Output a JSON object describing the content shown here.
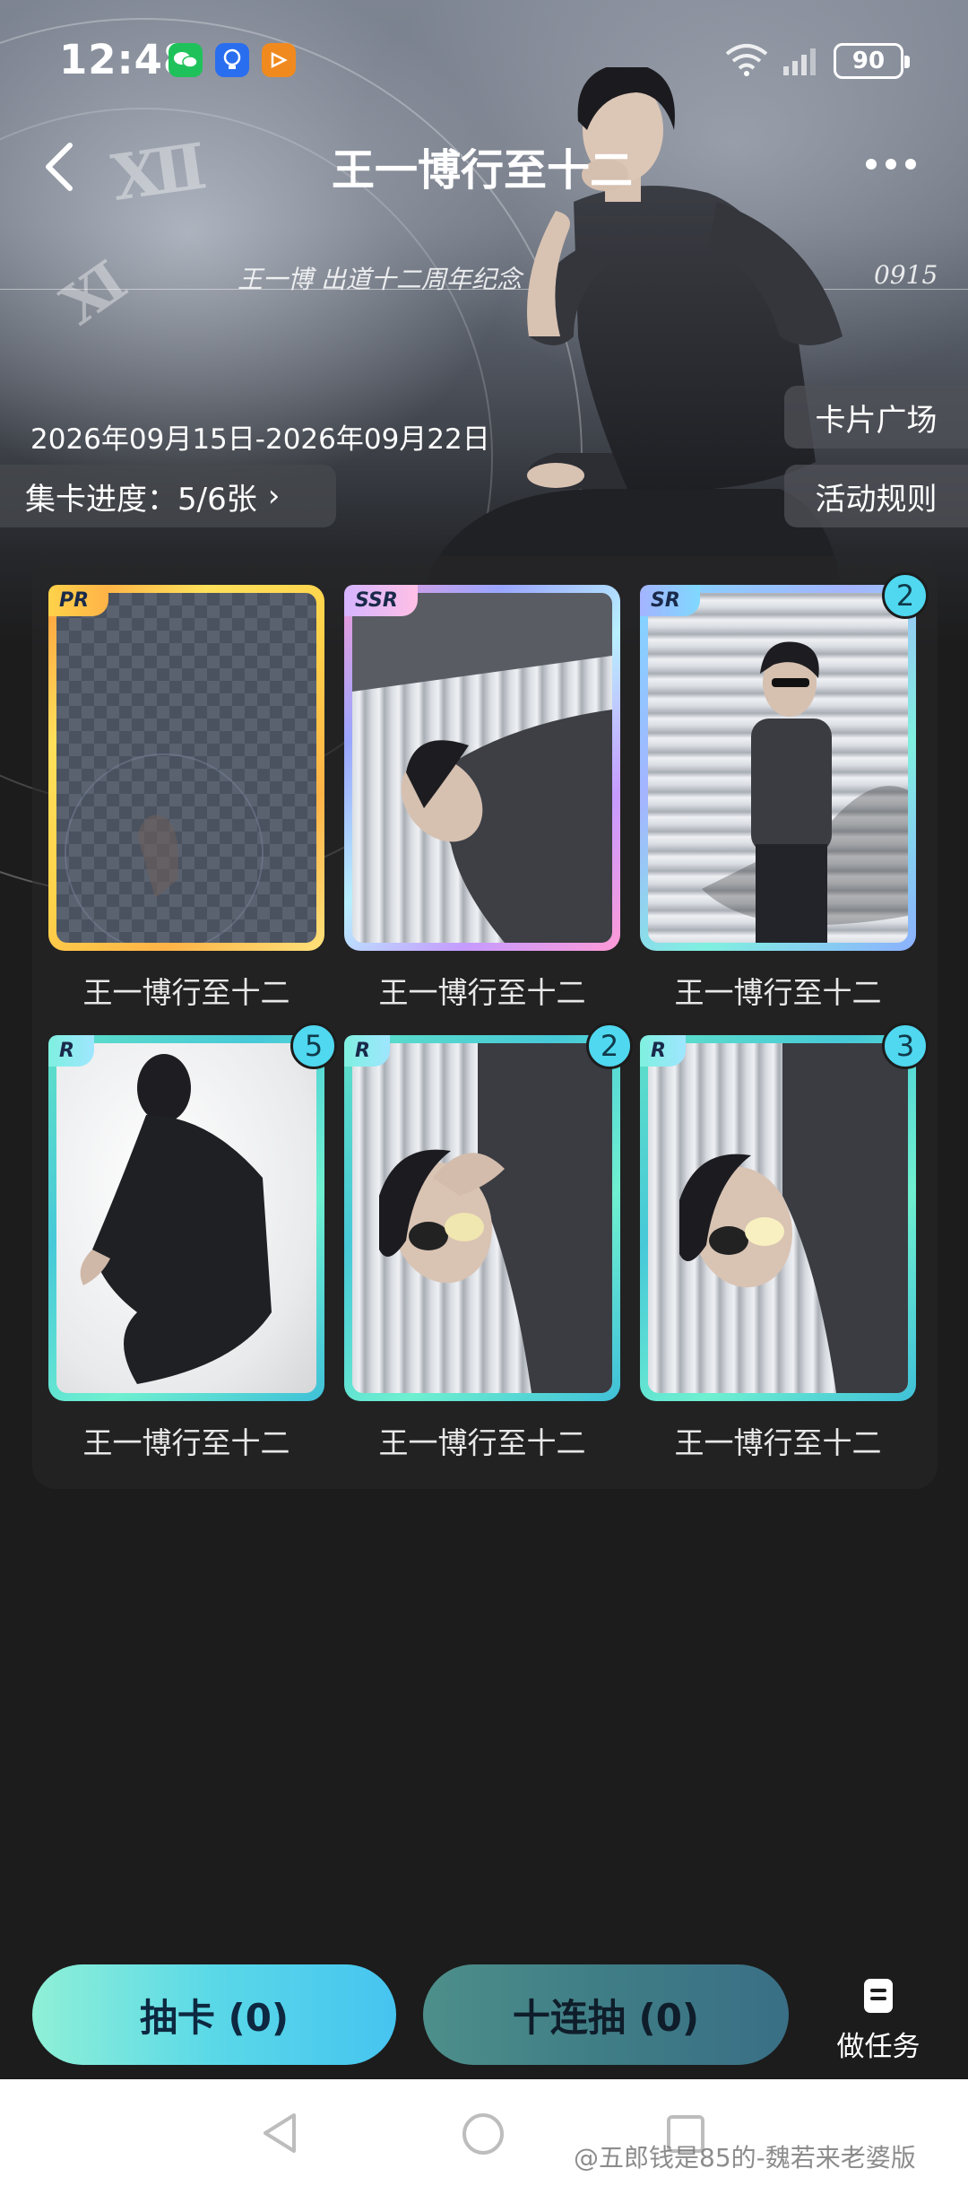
{
  "status": {
    "time": "12:48",
    "battery": "90",
    "icons": [
      "wechat-icon",
      "bulb-icon",
      "play-icon",
      "wifi-icon",
      "signal-icon",
      "battery-icon"
    ]
  },
  "header": {
    "title": "王一博行至十二",
    "subtitle": "王一博    出道十二周年纪念",
    "code": "0915"
  },
  "event": {
    "date_range": "2026年09月15日-2026年09月22日",
    "progress_label": "集卡进度：5/6张",
    "card_plaza": "卡片广场",
    "rules": "活动规则"
  },
  "cards": [
    {
      "rarity": "PR",
      "caption": "王一博行至十二",
      "count": ""
    },
    {
      "rarity": "SSR",
      "caption": "王一博行至十二",
      "count": ""
    },
    {
      "rarity": "SR",
      "caption": "王一博行至十二",
      "count": "2"
    },
    {
      "rarity": "R",
      "caption": "王一博行至十二",
      "count": "5"
    },
    {
      "rarity": "R",
      "caption": "王一博行至十二",
      "count": "2"
    },
    {
      "rarity": "R",
      "caption": "王一博行至十二",
      "count": "3"
    }
  ],
  "actions": {
    "draw_one": "抽卡 (0)",
    "draw_ten": "十连抽 (0)",
    "tasks": "做任务"
  },
  "watermark": "@五郎钱是85的-魏若来老婆版",
  "colors": {
    "pr_border": "#ffd24a",
    "ssr_border": "#b8a6ff",
    "sr_border": "#8cc0ff",
    "r_border": "#5fe0c8",
    "count_badge": "#4fd8f0"
  }
}
